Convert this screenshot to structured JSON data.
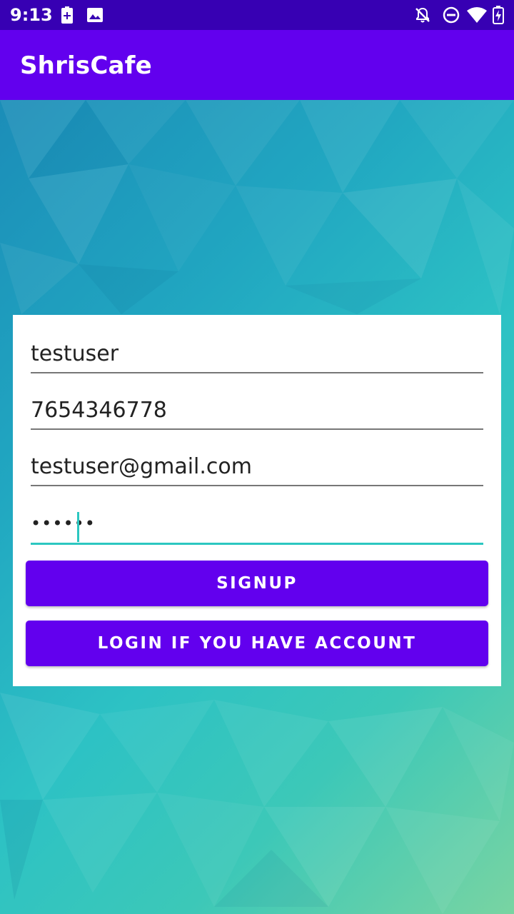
{
  "status_bar": {
    "time": "9:13",
    "left_icons": [
      "battery-saver-icon",
      "image-icon"
    ],
    "right_icons": [
      "notifications-off-icon",
      "do-not-disturb-icon",
      "wifi-icon",
      "battery-charging-icon"
    ]
  },
  "app_bar": {
    "title": "ShrisCafe"
  },
  "form": {
    "username": {
      "value": "testuser"
    },
    "phone": {
      "value": "7654346778"
    },
    "email": {
      "value": "testuser@gmail.com"
    },
    "password": {
      "value": "••••••"
    }
  },
  "buttons": {
    "signup_label": "SIGNUP",
    "login_label": "LOGIN IF YOU HAVE ACCOUNT"
  },
  "colors": {
    "status_bar": "#3700b3",
    "primary": "#6200ee",
    "accent": "#2cc7c0"
  }
}
